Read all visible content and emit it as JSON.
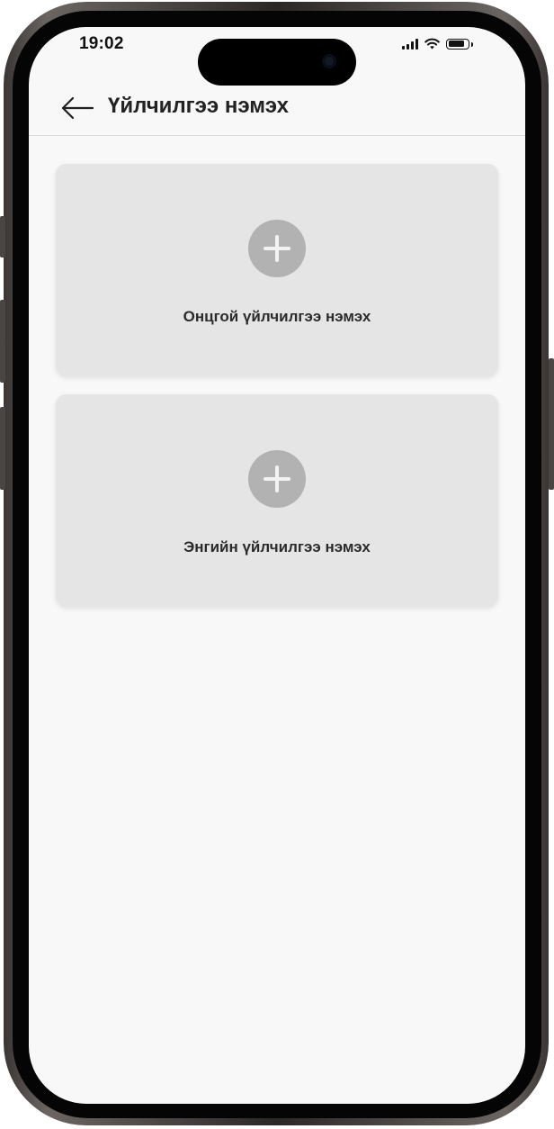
{
  "status_bar": {
    "time": "19:02"
  },
  "header": {
    "title": "Үйлчилгээ нэмэх",
    "back_icon": "arrow-left-icon"
  },
  "cards": [
    {
      "label": "Онцгой үйлчилгээ нэмэх",
      "icon": "plus-circle-icon"
    },
    {
      "label": "Энгийн үйлчилгээ нэмэх",
      "icon": "plus-circle-icon"
    }
  ],
  "colors": {
    "screen_bg": "#f8f8f8",
    "card_bg": "#e5e5e5",
    "icon_bg": "#b2b2b2",
    "text": "#222222"
  }
}
